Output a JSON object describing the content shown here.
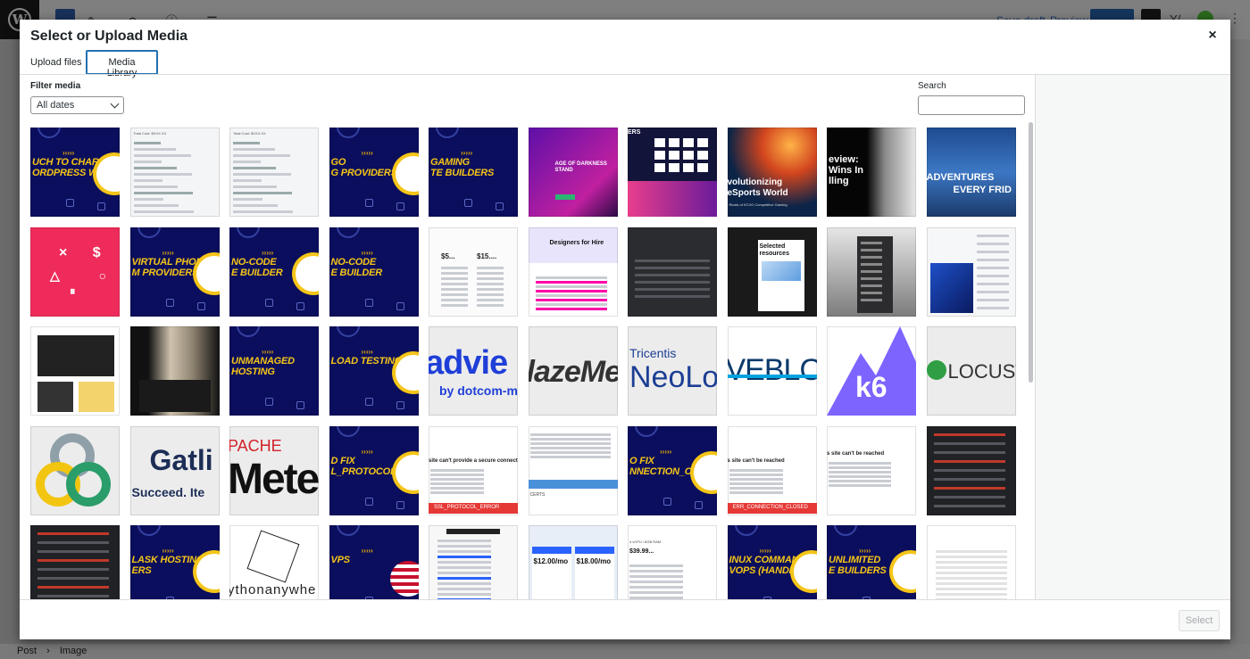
{
  "editor": {
    "logo": "W",
    "toolbar_icons": "✎ ↶ ⓘ ☰",
    "save_draft": "Save draft",
    "preview": "Preview",
    "publish": "Publish",
    "breadcrumb": [
      "Post",
      "›",
      "Image"
    ]
  },
  "modal": {
    "title": "Select or Upload Media",
    "close": "×",
    "tabs": [
      "Upload files",
      "Media Library"
    ],
    "active_tab": "Media Library",
    "filter_label": "Filter media",
    "date_filter": "All dates",
    "search_label": "Search",
    "search_value": "",
    "select_button": "Select"
  },
  "media_items": [
    {
      "kind": "navy",
      "text": [
        "UCH TO CHARGE",
        "ORDPRESS WEBSITE?"
      ]
    },
    {
      "kind": "doc",
      "text": [
        "Total Cost: $XXX.XX"
      ]
    },
    {
      "kind": "doc",
      "text": [
        "Total Cost: $XXX.XX"
      ]
    },
    {
      "kind": "navy",
      "text": [
        "GO",
        "G PROVIDERS"
      ]
    },
    {
      "kind": "navy",
      "text": [
        "GAMING",
        "TE BUILDERS"
      ]
    },
    {
      "kind": "purple",
      "text": [
        "AGE OF DARKNESS",
        "STAND"
      ]
    },
    {
      "kind": "dark-grid",
      "text": [
        "ERS"
      ]
    },
    {
      "kind": "space",
      "text": [
        "volutionizing",
        "eSports World",
        "Rivals of KCVO Competitive Gaming"
      ]
    },
    {
      "kind": "review",
      "text": [
        "eview:",
        "Wins In",
        "lling"
      ]
    },
    {
      "kind": "adventure",
      "text": [
        "ADVENTURES",
        "EVERY FRID"
      ]
    },
    {
      "kind": "pink",
      "text": [
        "× $",
        "△ ○",
        "⏸"
      ]
    },
    {
      "kind": "navy",
      "text": [
        "VIRTUAL PHONE",
        "M PROVIDERS"
      ]
    },
    {
      "kind": "navy",
      "text": [
        "NO-CODE",
        "E BUILDER"
      ]
    },
    {
      "kind": "navy",
      "text": [
        "NO-CODE",
        "E BUILDER"
      ]
    },
    {
      "kind": "pricing",
      "text": [
        "$5...",
        "$15...."
      ]
    },
    {
      "kind": "designers",
      "text": [
        "Designers for Hire"
      ]
    },
    {
      "kind": "darkui",
      "text": []
    },
    {
      "kind": "selected",
      "text": [
        "Selected",
        "resources"
      ]
    },
    {
      "kind": "greyui",
      "text": []
    },
    {
      "kind": "blueui",
      "text": []
    },
    {
      "kind": "collage",
      "text": []
    },
    {
      "kind": "curtain",
      "text": []
    },
    {
      "kind": "navy",
      "text": [
        "UNMANAGED",
        "HOSTING"
      ]
    },
    {
      "kind": "navy",
      "text": [
        "LOAD TESTING"
      ]
    },
    {
      "kind": "logo-advie",
      "text": [
        "advie",
        "by dotcom-m"
      ]
    },
    {
      "kind": "logo-blaze",
      "text": [
        "lazeMe"
      ]
    },
    {
      "kind": "logo-neo",
      "text": [
        "Tricentis",
        "NeoLo"
      ]
    },
    {
      "kind": "logo-webload",
      "text": [
        "VEBLOA"
      ]
    },
    {
      "kind": "logo-k6",
      "text": [
        "k6"
      ]
    },
    {
      "kind": "logo-locust",
      "text": [
        "LOCUST"
      ]
    },
    {
      "kind": "logo-rings",
      "text": []
    },
    {
      "kind": "logo-gatling",
      "text": [
        "Gatli",
        "Succeed. Ite"
      ]
    },
    {
      "kind": "logo-jmeter",
      "text": [
        "PACHE",
        "Mete"
      ]
    },
    {
      "kind": "navy",
      "text": [
        "D FIX",
        "L_PROTOCOL_ERROR"
      ]
    },
    {
      "kind": "err-red",
      "text": [
        "site can't provide a secure connection",
        "SSL_PROTOCOL_ERROR"
      ]
    },
    {
      "kind": "err-blue",
      "text": [
        "CERTS"
      ]
    },
    {
      "kind": "navy",
      "text": [
        "O FIX",
        "NNECTION_CLOSED"
      ]
    },
    {
      "kind": "err-closed",
      "text": [
        "s site can't be reached",
        "ERR_CONNECTION_CLOSED"
      ]
    },
    {
      "kind": "err-plain",
      "text": [
        "s site can't be reached"
      ]
    },
    {
      "kind": "darkdash",
      "text": []
    },
    {
      "kind": "darkdash2",
      "text": []
    },
    {
      "kind": "navy",
      "text": [
        "LASK HOSTING",
        "ERS"
      ]
    },
    {
      "kind": "logo-python",
      "text": [
        "ythonanywhe"
      ]
    },
    {
      "kind": "navy-flag",
      "text": [
        "VPS"
      ]
    },
    {
      "kind": "plans",
      "text": []
    },
    {
      "kind": "prices",
      "text": [
        "$12.00/mo",
        "$18.00/mo"
      ]
    },
    {
      "kind": "ram",
      "text": [
        "4 vCPU / 8GB RAM",
        "$39.99..."
      ]
    },
    {
      "kind": "navy",
      "text": [
        "INUX COMMANDS",
        "VOPS (HANDBOOK)"
      ]
    },
    {
      "kind": "navy",
      "text": [
        "UNLIMITED",
        "E BUILDERS"
      ]
    },
    {
      "kind": "table",
      "text": []
    }
  ]
}
